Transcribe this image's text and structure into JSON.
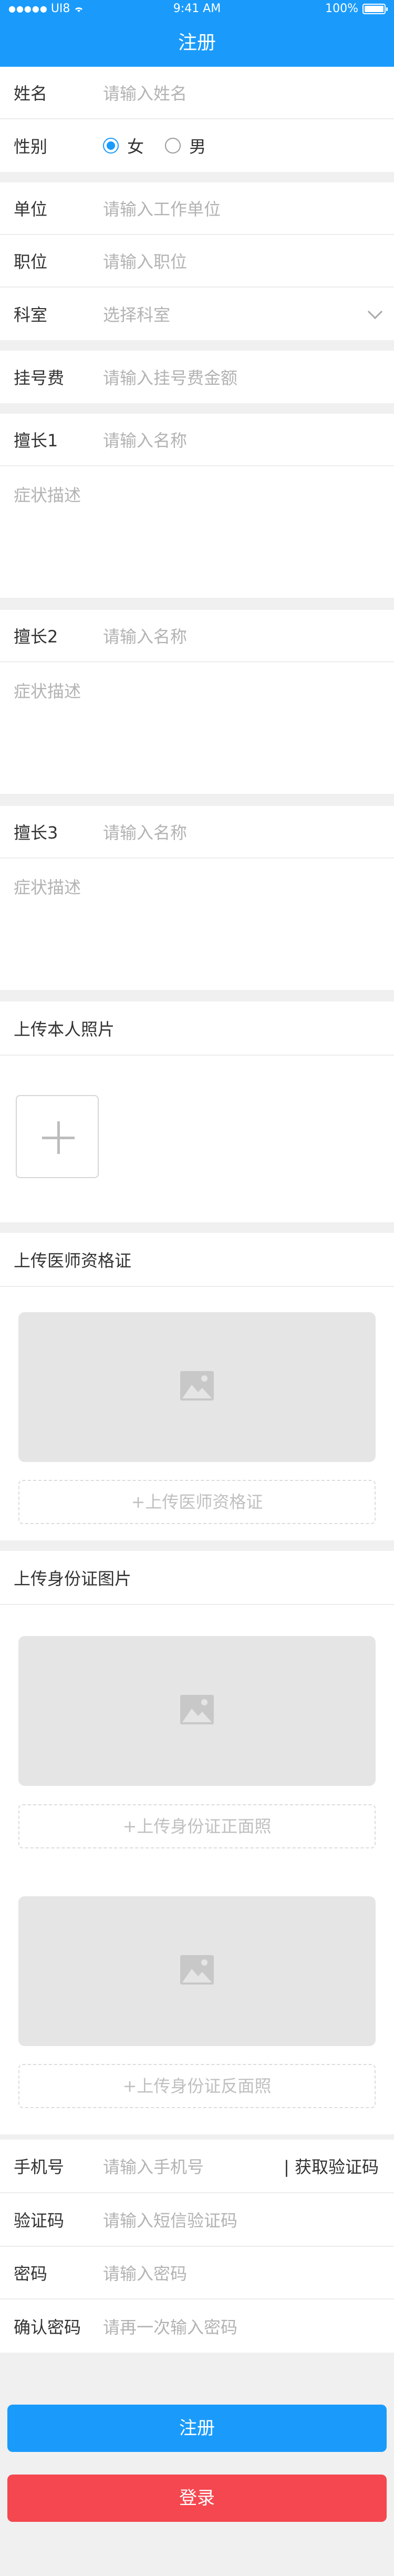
{
  "status_bar": {
    "carrier": "UI8",
    "time": "9:41 AM",
    "battery": "100%"
  },
  "header": {
    "title": "注册"
  },
  "basic": {
    "name_label": "姓名",
    "name_placeholder": "请输入姓名",
    "gender_label": "性别",
    "gender_options": [
      "女",
      "男"
    ],
    "gender_selected": "女"
  },
  "work": {
    "unit_label": "单位",
    "unit_placeholder": "请输入工作单位",
    "position_label": "职位",
    "position_placeholder": "请输入职位",
    "dept_label": "科室",
    "dept_placeholder": "选择科室"
  },
  "fee": {
    "label": "挂号费",
    "placeholder": "请输入挂号费金额"
  },
  "specialties": [
    {
      "label": "擅长1",
      "name_placeholder": "请输入名称",
      "desc_placeholder": "症状描述"
    },
    {
      "label": "擅长2",
      "name_placeholder": "请输入名称",
      "desc_placeholder": "症状描述"
    },
    {
      "label": "擅长3",
      "name_placeholder": "请输入名称",
      "desc_placeholder": "症状描述"
    }
  ],
  "photo": {
    "title": "上传本人照片"
  },
  "license": {
    "title": "上传医师资格证",
    "button": "+上传医师资格证"
  },
  "id_card": {
    "title": "上传身份证图片",
    "front_button": "+上传身份证正面照",
    "back_button": "+上传身份证反面照"
  },
  "account": {
    "phone_label": "手机号",
    "phone_placeholder": "请输入手机号",
    "get_code": "| 获取验证码",
    "code_label": "验证码",
    "code_placeholder": "请输入短信验证码",
    "password_label": "密码",
    "password_placeholder": "请输入密码",
    "confirm_label": "确认密码",
    "confirm_placeholder": "请再一次输入密码"
  },
  "actions": {
    "register": "注册",
    "login": "登录"
  },
  "colors": {
    "primary": "#1a9bfc",
    "danger": "#f5474f"
  }
}
